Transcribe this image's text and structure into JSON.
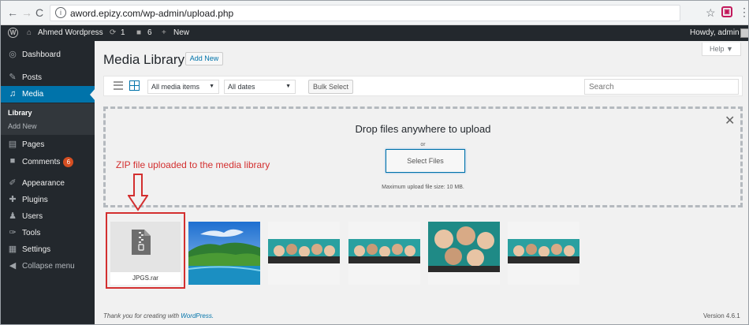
{
  "browser": {
    "url": "aword.epizy.com/wp-admin/upload.php",
    "back_icon": "back-arrow",
    "forward_icon": "forward-arrow",
    "reload_icon": "reload"
  },
  "adminbar": {
    "site_name": "Ahmed Wordpress",
    "updates": "1",
    "comments": "6",
    "new_label": "New",
    "howdy": "Howdy, admin"
  },
  "sidebar": {
    "dashboard": "Dashboard",
    "posts": "Posts",
    "media": "Media",
    "library": "Library",
    "add_new": "Add New",
    "pages": "Pages",
    "comments": "Comments",
    "comments_badge": "6",
    "appearance": "Appearance",
    "plugins": "Plugins",
    "users": "Users",
    "tools": "Tools",
    "settings": "Settings",
    "collapse": "Collapse menu"
  },
  "main": {
    "help": "Help ▼",
    "title": "Media Library",
    "add_new": "Add New",
    "filter_type": "All media items",
    "filter_date": "All dates",
    "bulk_select": "Bulk Select",
    "search_placeholder": "Search",
    "drop_title": "Drop files anywhere to upload",
    "drop_or": "or",
    "select_files": "Select Files",
    "max_size": "Maximum upload file size: 10 MB.",
    "annotation": "ZIP file uploaded to the media library",
    "zip_filename": "JPGS.rar",
    "footer_thanks": "Thank you for creating with",
    "footer_link": "WordPress.",
    "version": "Version 4.6.1"
  },
  "colors": {
    "admin_bg": "#23282d",
    "accent": "#0073aa",
    "annotation": "#d32f2f",
    "badge": "#d54e21"
  }
}
